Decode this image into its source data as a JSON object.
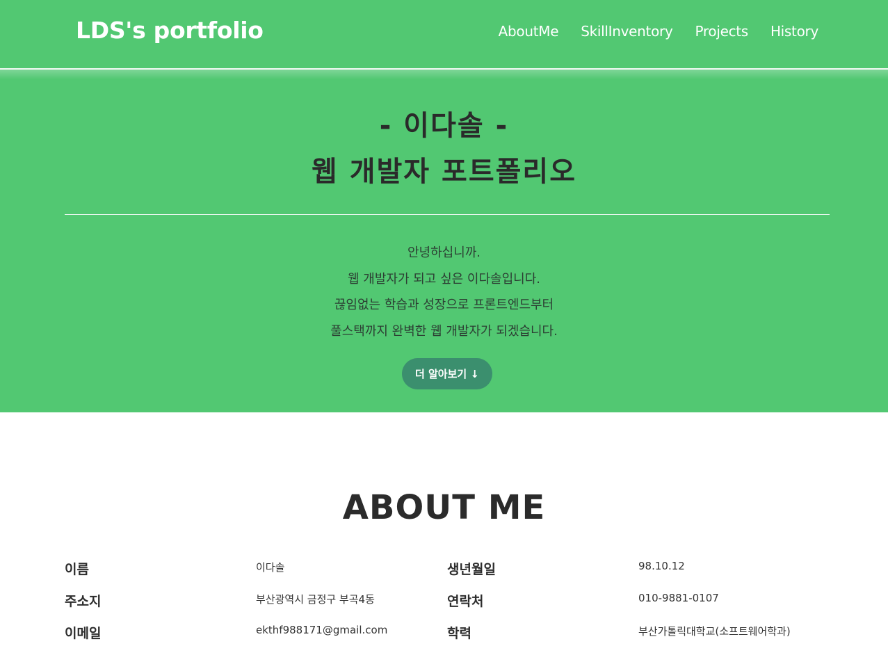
{
  "header": {
    "brand": "LDS's portfolio",
    "nav": [
      "AboutMe",
      "SkillInventory",
      "Projects",
      "History"
    ]
  },
  "hero": {
    "title_line1": "- 이다솔 -",
    "title_line2": "웹 개발자 포트폴리오",
    "intro": [
      "안녕하십니까.",
      "웹 개발자가 되고 싶은 이다솔입니다.",
      "끊임없는 학습과 성장으로 프론트엔드부터",
      "풀스택까지 완벽한 웹 개발자가 되겠습니다."
    ],
    "cta_label": "더 알아보기 ↓"
  },
  "about": {
    "title": "ABOUT ME",
    "rows": [
      {
        "label1": "이름",
        "value1": "이다솔",
        "label2": "생년월일",
        "value2": "98.10.12"
      },
      {
        "label1": "주소지",
        "value1": "부산광역시 금정구 부곡4동",
        "label2": "연락처",
        "value2": "010-9881-0107"
      },
      {
        "label1": "이메일",
        "value1": "ekthf988171@gmail.com",
        "label2": "학력",
        "value2": "부산가톨릭대학교(소프트웨어학과)"
      }
    ]
  },
  "colors": {
    "primary_green": "#52c872",
    "button_green": "#3b8f6e",
    "text_dark": "#2b2b2b"
  }
}
